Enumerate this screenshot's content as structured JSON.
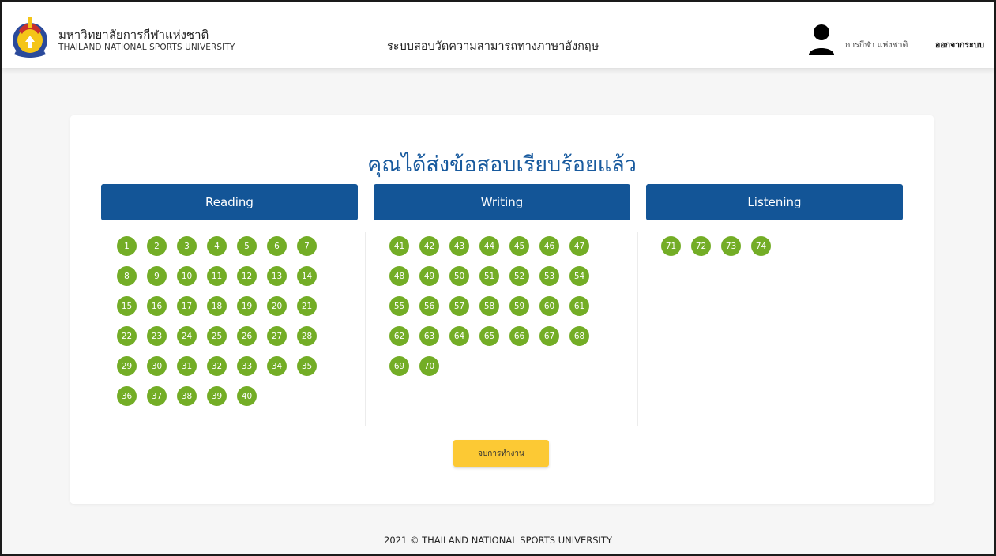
{
  "header": {
    "university_th": "มหาวิทยาลัยการกีฬาแห่งชาติ",
    "university_en": "THAILAND NATIONAL SPORTS UNIVERSITY",
    "system_title": "ระบบสอบวัดความสามารถทางภาษาอังกฤษ",
    "user_name": "การกีฬา แห่งชาติ",
    "logout_label": "ออกจากระบบ",
    "avatar_icon": "user-silhouette-icon",
    "logo_icon": "university-logo-icon"
  },
  "main": {
    "heading": "คุณได้ส่งข้อสอบเรียบร้อยแล้ว",
    "sections": [
      {
        "title": "Reading",
        "numbers": [
          "1",
          "2",
          "3",
          "4",
          "5",
          "6",
          "7",
          "8",
          "9",
          "10",
          "11",
          "12",
          "13",
          "14",
          "15",
          "16",
          "17",
          "18",
          "19",
          "20",
          "21",
          "22",
          "23",
          "24",
          "25",
          "26",
          "27",
          "28",
          "29",
          "30",
          "31",
          "32",
          "33",
          "34",
          "35",
          "36",
          "37",
          "38",
          "39",
          "40"
        ]
      },
      {
        "title": "Writing",
        "numbers": [
          "41",
          "42",
          "43",
          "44",
          "45",
          "46",
          "47",
          "48",
          "49",
          "50",
          "51",
          "52",
          "53",
          "54",
          "55",
          "56",
          "57",
          "58",
          "59",
          "60",
          "61",
          "62",
          "63",
          "64",
          "65",
          "66",
          "67",
          "68",
          "69",
          "70"
        ]
      },
      {
        "title": "Listening",
        "numbers": [
          "71",
          "72",
          "73",
          "74"
        ]
      }
    ],
    "end_button_label": "จบการทำงาน"
  },
  "footer": {
    "text": "2021 © THAILAND NATIONAL SPORTS UNIVERSITY"
  },
  "colors": {
    "section_header_bg": "#135597",
    "heading_text": "#185a9e",
    "question_circle": "#73ad26",
    "end_button": "#fcc934"
  }
}
